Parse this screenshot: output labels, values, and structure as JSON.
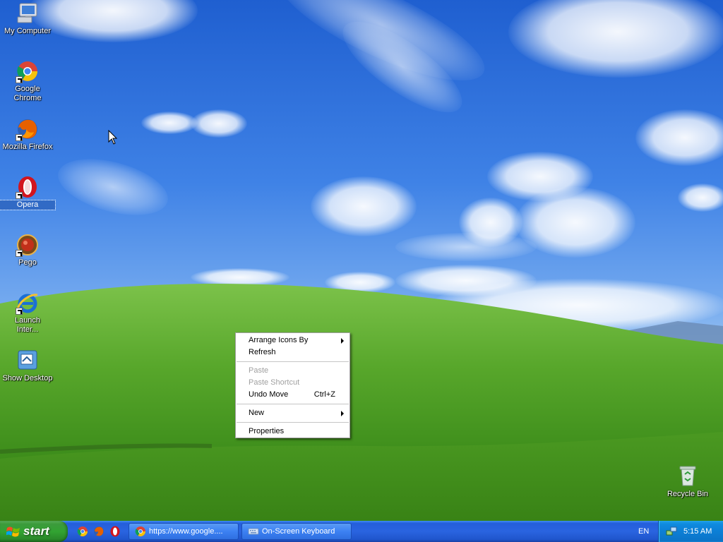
{
  "desktop": {
    "icons": [
      {
        "label": "My Computer"
      },
      {
        "label": "Google Chrome"
      },
      {
        "label": "Mozilla Firefox"
      },
      {
        "label": "Opera"
      },
      {
        "label": "Pego"
      },
      {
        "label": "Launch Inter..."
      },
      {
        "label": "Show Desktop"
      },
      {
        "label": "Recycle Bin"
      }
    ]
  },
  "context_menu": {
    "arrange_icons_by": "Arrange Icons By",
    "refresh": "Refresh",
    "paste": "Paste",
    "paste_shortcut": "Paste Shortcut",
    "undo_move": "Undo Move",
    "undo_move_shortcut": "Ctrl+Z",
    "new": "New",
    "properties": "Properties"
  },
  "taskbar": {
    "start_label": "start",
    "tasks": [
      {
        "label": "https://www.google...."
      },
      {
        "label": "On-Screen Keyboard"
      }
    ],
    "language": "EN",
    "clock": "5:15 AM"
  },
  "colors": {
    "taskbar": "#245edb",
    "start_button": "#32a332",
    "tray": "#0c7fd6",
    "selection": "#316ac5"
  }
}
